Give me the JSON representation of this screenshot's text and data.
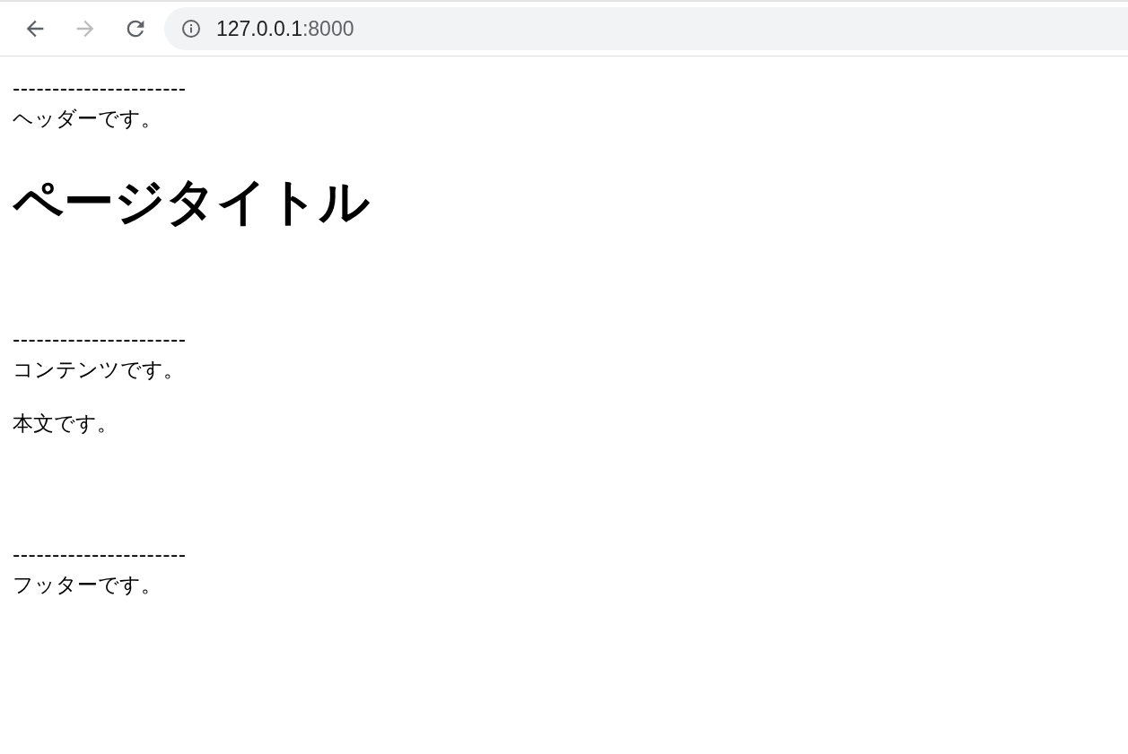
{
  "toolbar": {
    "back": {
      "disabled": false
    },
    "forward": {
      "disabled": true
    },
    "address": {
      "host": "127.0.0.1",
      "port": ":8000"
    }
  },
  "header": {
    "rule": "----------------------",
    "text": "ヘッダーです。"
  },
  "title": "ページタイトル",
  "content": {
    "rule": "----------------------",
    "text": "コンテンツです。",
    "body": "本文です。"
  },
  "footer": {
    "rule": "----------------------",
    "text": "フッターです。"
  }
}
